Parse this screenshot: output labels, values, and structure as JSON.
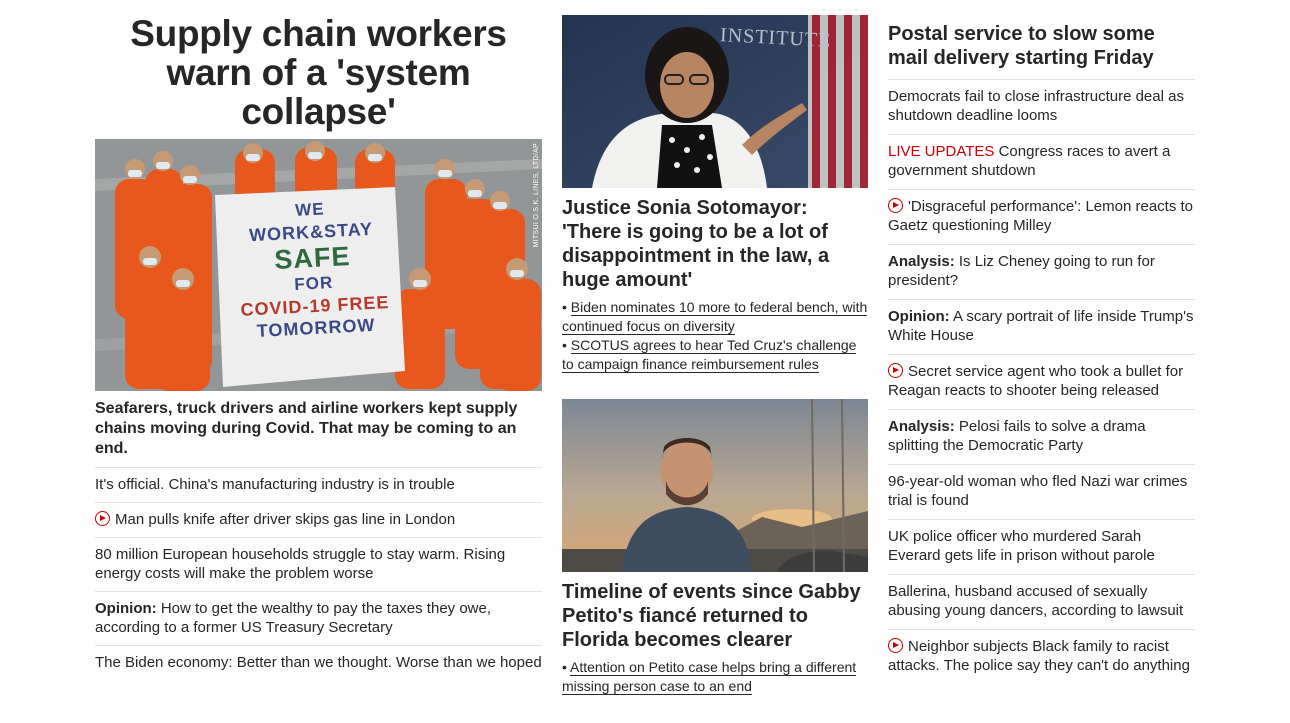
{
  "col1": {
    "headline": "Supply chain workers warn of a 'system collapse'",
    "hero_image": {
      "alt": "Seafarers in orange coveralls holding a banner",
      "banner_lines": [
        "WE",
        "WORK&STAY",
        "SAFE",
        "FOR",
        "COVID-19 FREE",
        "TOMORROW"
      ],
      "credit": "MITSUI O.S.K. LINES, LTD/AP"
    },
    "caption": "Seafarers, truck drivers and airline workers kept supply chains moving during Covid. That may be coming to an end.",
    "items": [
      {
        "lead": "",
        "text": "It's official. China's manufacturing industry is in trouble"
      },
      {
        "lead": "",
        "text": "Man pulls knife after driver skips gas line in London"
      },
      {
        "lead": "",
        "text": "80 million European households struggle to stay warm. Rising energy costs will make the problem worse"
      },
      {
        "lead": "Opinion:",
        "text": " How to get the wealthy to pay the taxes they owe, according to a former US Treasury Secretary"
      },
      {
        "lead": "",
        "text": "The Biden economy: Better than we thought. Worse than we hoped"
      }
    ]
  },
  "col2": {
    "story1": {
      "image_bg_text": "INSTITUTE",
      "headline": "Justice Sonia Sotomayor: 'There is going to be a lot of disappointment in the law, a huge amount'",
      "related": [
        "Biden nominates 10 more to federal bench, with continued focus on diversity",
        "SCOTUS agrees to hear Ted Cruz's challenge to campaign finance reimbursement rules"
      ]
    },
    "story2": {
      "headline": "Timeline of events since Gabby Petito's fiancé returned to Florida becomes clearer",
      "related": [
        "Attention on Petito case helps bring a different missing person case to an end"
      ]
    }
  },
  "col3": {
    "headline": "Postal service to slow some mail delivery starting Friday",
    "items": [
      {
        "live": "",
        "lead": "",
        "text": "Democrats fail to close infrastructure deal as shutdown deadline looms"
      },
      {
        "live": "LIVE UPDATES",
        "lead": "",
        "text": " Congress races to avert a government shutdown"
      },
      {
        "live": "",
        "lead": "",
        "text": "'Disgraceful performance': Lemon reacts to Gaetz questioning Milley"
      },
      {
        "live": "",
        "lead": "Analysis:",
        "text": " Is Liz Cheney going to run for president?"
      },
      {
        "live": "",
        "lead": "Opinion:",
        "text": " A scary portrait of life inside Trump's White House"
      },
      {
        "live": "",
        "lead": "",
        "text": "Secret service agent who took a bullet for Reagan reacts to shooter being released"
      },
      {
        "live": "",
        "lead": "Analysis:",
        "text": " Pelosi fails to solve a drama splitting the Democratic Party"
      },
      {
        "live": "",
        "lead": "",
        "text": "96-year-old woman who fled Nazi war crimes trial is found"
      },
      {
        "live": "",
        "lead": "",
        "text": "UK police officer who murdered Sarah Everard gets life in prison without parole"
      },
      {
        "live": "",
        "lead": "",
        "text": "Ballerina, husband accused of sexually abusing young dancers, according to lawsuit"
      },
      {
        "live": "",
        "lead": "",
        "text": "Neighbor subjects Black family to racist attacks. The police say they can't do anything"
      }
    ]
  },
  "colors": {
    "text": "#262626",
    "live": "#cc0000",
    "divider": "#e1e1e1",
    "play_icon": "#cc0000"
  }
}
